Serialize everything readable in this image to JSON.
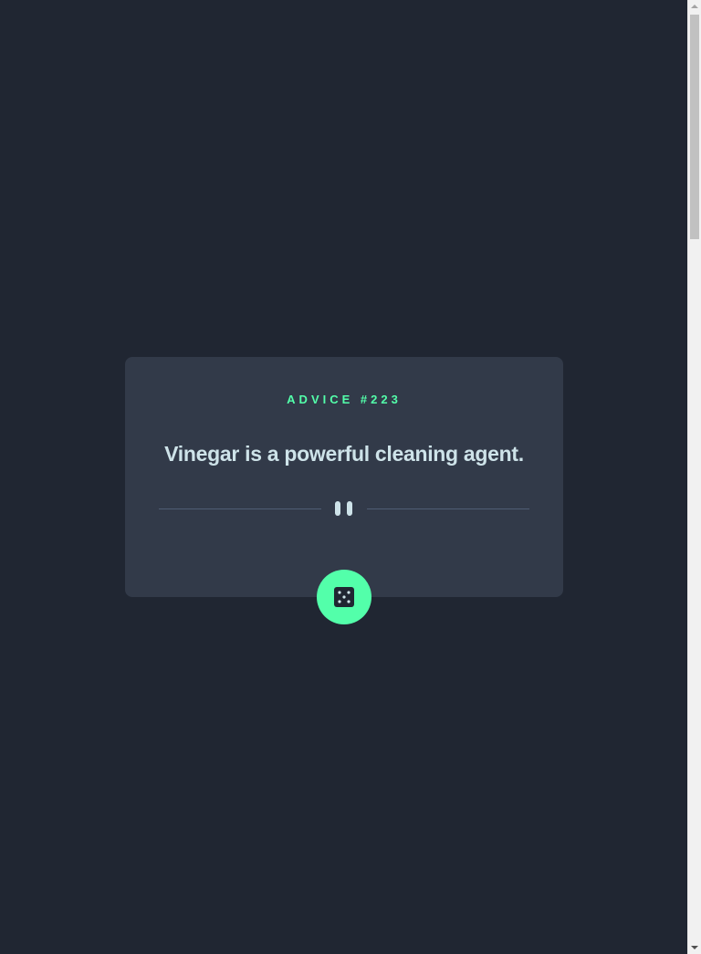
{
  "advice": {
    "heading": "ADVICE #223",
    "text": "Vinegar is a powerful cleaning agent."
  },
  "icons": {
    "divider": "pause-icon",
    "dice": "dice-icon"
  },
  "colors": {
    "background": "#202632",
    "card": "#323a49",
    "accent": "#53ffaa",
    "text": "#cee3e9",
    "divider_line": "#4f5d74"
  }
}
